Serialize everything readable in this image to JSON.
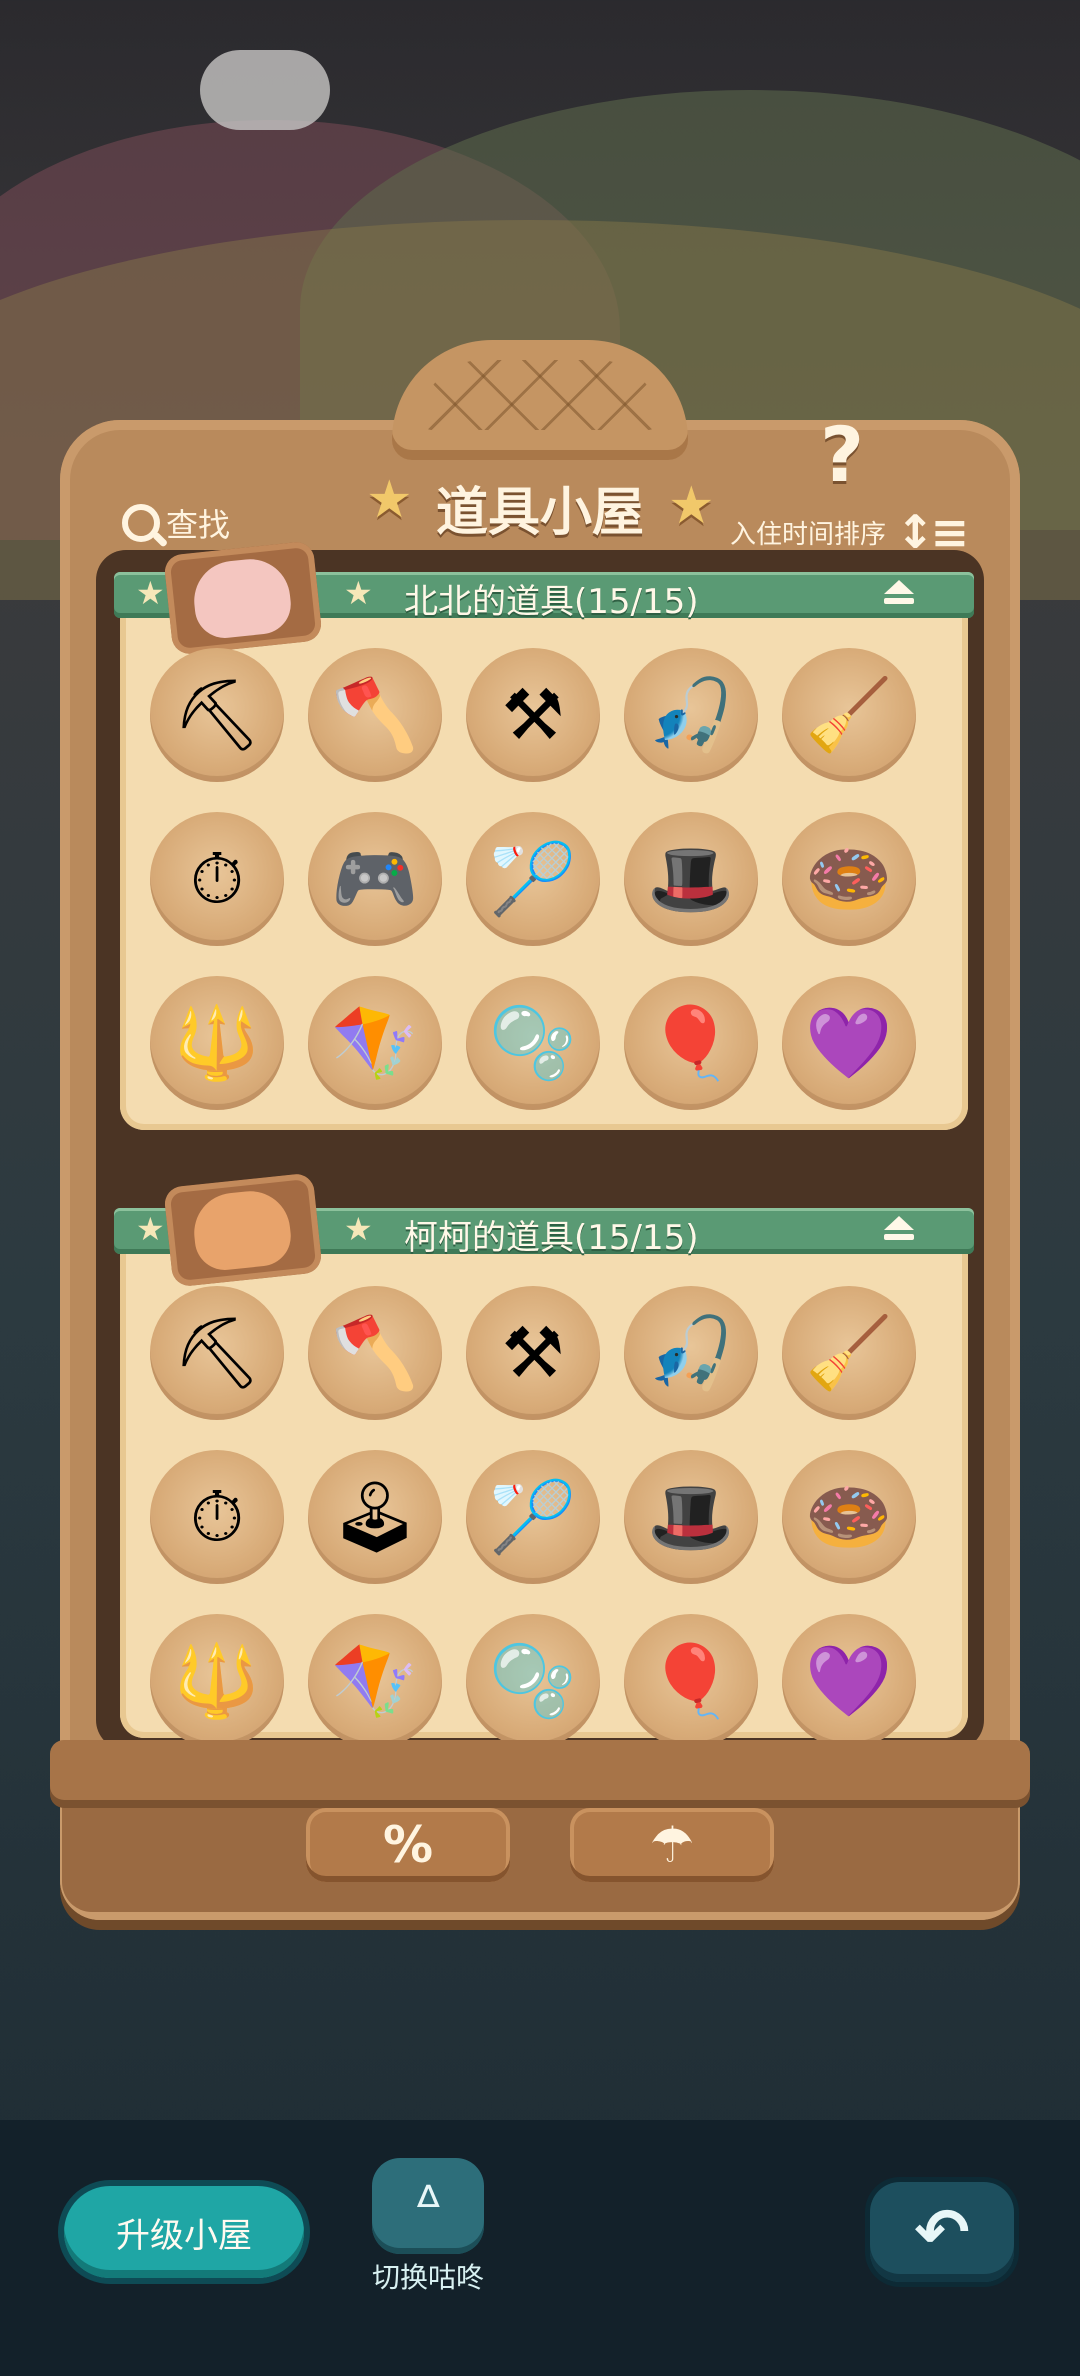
{
  "header": {
    "title": "道具小屋",
    "search_label": "查找",
    "sort_label": "入住时间排序",
    "help_label": "?"
  },
  "sections": [
    {
      "title": "北北的道具(15/15)",
      "items": [
        {
          "icon": "pickaxe-icon",
          "glyph": "⛏"
        },
        {
          "icon": "axe-icon",
          "glyph": "🪓"
        },
        {
          "icon": "shovel-icon",
          "glyph": "⚒"
        },
        {
          "icon": "fishing-rod-icon",
          "glyph": "🎣"
        },
        {
          "icon": "broom-icon",
          "glyph": "🧹"
        },
        {
          "icon": "clock-star-tag-icon",
          "glyph": "⏱"
        },
        {
          "icon": "orange-game-device-icon",
          "glyph": "🎮"
        },
        {
          "icon": "bug-net-icon",
          "glyph": "🏸"
        },
        {
          "icon": "red-hat-figure-icon",
          "glyph": "🎩"
        },
        {
          "icon": "float-ring-icon",
          "glyph": "🍩"
        },
        {
          "icon": "rake-icon",
          "glyph": "🔱"
        },
        {
          "icon": "flying-squirrel-glider-icon",
          "glyph": "🪁"
        },
        {
          "icon": "bubble-icon",
          "glyph": "🫧"
        },
        {
          "icon": "blue-balloon-icon",
          "glyph": "🎈"
        },
        {
          "icon": "heart-balloon-icon",
          "glyph": "💜"
        }
      ]
    },
    {
      "title": "柯柯的道具(15/15)",
      "items": [
        {
          "icon": "pickaxe-icon",
          "glyph": "⛏"
        },
        {
          "icon": "axe-icon",
          "glyph": "🪓"
        },
        {
          "icon": "shovel-icon",
          "glyph": "⚒"
        },
        {
          "icon": "fishing-rod-icon",
          "glyph": "🎣"
        },
        {
          "icon": "broom-icon",
          "glyph": "🧹"
        },
        {
          "icon": "clock-star-tag-icon",
          "glyph": "⏱"
        },
        {
          "icon": "red-game-device-icon",
          "glyph": "🕹"
        },
        {
          "icon": "bug-net-icon",
          "glyph": "🏸"
        },
        {
          "icon": "red-hat-figure-icon",
          "glyph": "🎩"
        },
        {
          "icon": "float-ring-icon",
          "glyph": "🍩"
        },
        {
          "icon": "rake-icon",
          "glyph": "🔱"
        },
        {
          "icon": "flying-squirrel-glider-icon",
          "glyph": "🪁"
        },
        {
          "icon": "bubble-icon",
          "glyph": "🫧"
        },
        {
          "icon": "blue-balloon-icon",
          "glyph": "🎈"
        },
        {
          "icon": "heart-balloon-icon",
          "glyph": "💜"
        }
      ]
    }
  ],
  "tool_buttons": [
    {
      "icon": "discount-icon",
      "glyph": "%"
    },
    {
      "icon": "umbrella-icon",
      "glyph": "☂"
    }
  ],
  "footer": {
    "upgrade_label": "升级小屋",
    "switch_label": "切换咕咚",
    "back_glyph": "↶"
  },
  "colors": {
    "panel_bg": "#f4dcb0",
    "header_green": "#5a9a74",
    "wood": "#b98a5c",
    "teal_button": "#1fa6a5"
  }
}
